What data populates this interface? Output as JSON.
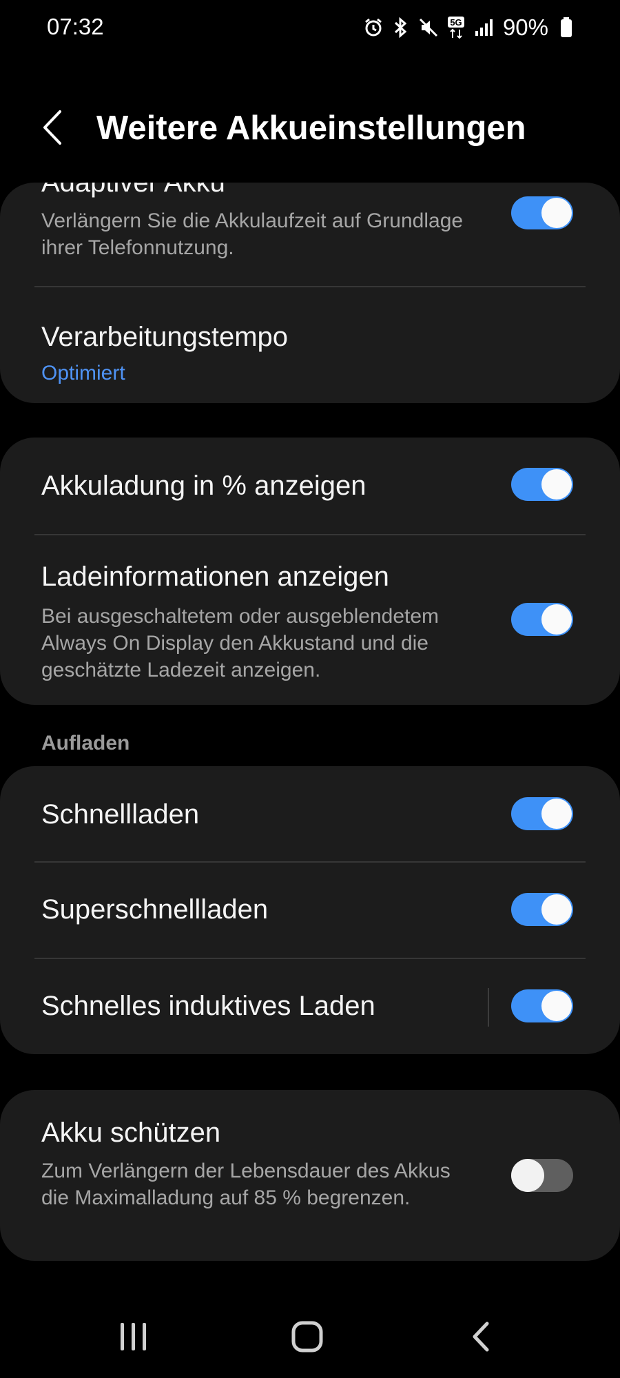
{
  "status_bar": {
    "time": "07:32",
    "network": "5G",
    "battery_percent": "90%"
  },
  "header": {
    "title": "Weitere Akkueinstellungen"
  },
  "group1": {
    "adaptive": {
      "title": "Adaptiver Akku",
      "subtitle": "Verlängern Sie die Akkulaufzeit auf Grundlage ihrer Telefonnutzung.",
      "enabled": true
    },
    "speed": {
      "title": "Verarbeitungstempo",
      "value": "Optimiert"
    }
  },
  "group2": {
    "percent": {
      "title": "Akkuladung in % anzeigen",
      "enabled": true
    },
    "chargeinfo": {
      "title": "Ladeinformationen anzeigen",
      "subtitle": "Bei ausgeschaltetem oder ausgeblendetem Always On Display den Akkustand und die geschätzte Ladezeit anzeigen.",
      "enabled": true
    }
  },
  "charging": {
    "section_label": "Aufladen",
    "fast": {
      "title": "Schnellladen",
      "enabled": true
    },
    "superfast": {
      "title": "Superschnellladen",
      "enabled": true
    },
    "wireless": {
      "title": "Schnelles induktives Laden",
      "enabled": true
    }
  },
  "protect": {
    "title": "Akku schützen",
    "subtitle": "Zum Verlängern der Lebensdauer des Akkus die Maximalladung auf 85 % begrenzen.",
    "enabled": false
  },
  "colors": {
    "accent": "#3e91f7",
    "card": "#1c1c1c",
    "background": "#000000"
  }
}
